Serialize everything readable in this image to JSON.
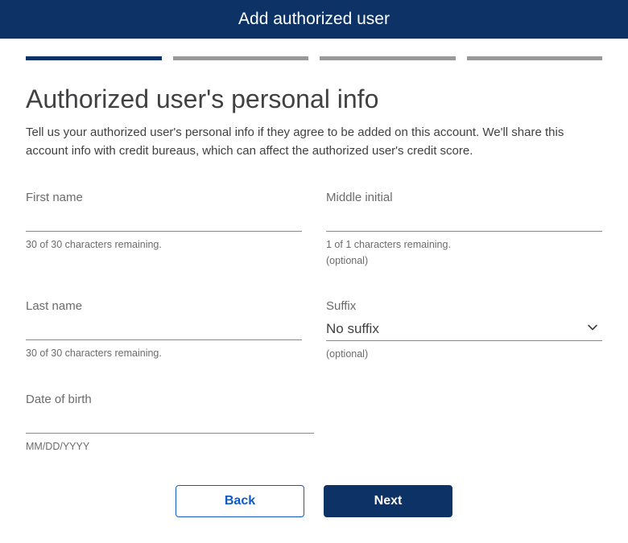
{
  "header": {
    "title": "Add authorized user"
  },
  "progress": {
    "total_steps": 4,
    "current_step": 1
  },
  "page": {
    "title": "Authorized user's personal info",
    "description": "Tell us your authorized user's personal info if they agree to be added on this account. We'll share this account info with credit bureaus, which can affect the authorized user's credit score."
  },
  "fields": {
    "first_name": {
      "label": "First name",
      "value": "",
      "helper": "30 of 30 characters remaining."
    },
    "middle_initial": {
      "label": "Middle initial",
      "value": "",
      "helper": "1 of 1 characters remaining.",
      "optional_text": "(optional)"
    },
    "last_name": {
      "label": "Last name",
      "value": "",
      "helper": "30 of 30 characters remaining."
    },
    "suffix": {
      "label": "Suffix",
      "selected": "No suffix",
      "optional_text": "(optional)"
    },
    "dob": {
      "label": "Date of birth",
      "value": "",
      "helper": "MM/DD/YYYY"
    }
  },
  "buttons": {
    "back": "Back",
    "next": "Next"
  }
}
